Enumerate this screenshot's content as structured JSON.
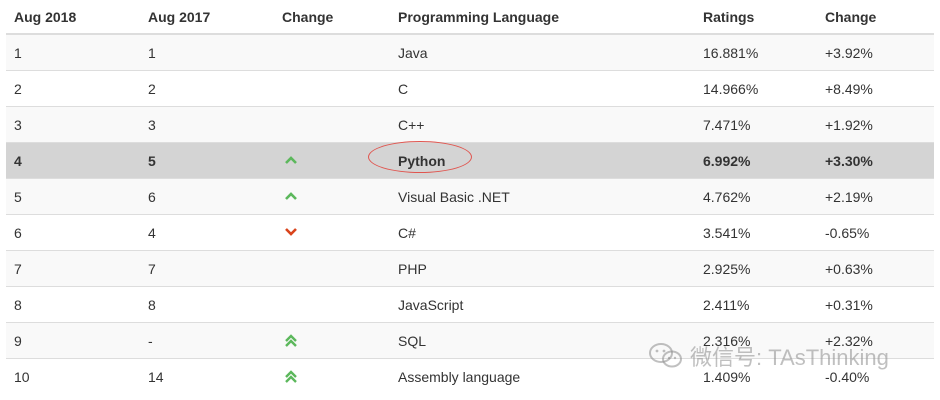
{
  "headers": [
    "Aug 2018",
    "Aug 2017",
    "Change",
    "Programming Language",
    "Ratings",
    "Change"
  ],
  "rows": [
    {
      "aug2018": "1",
      "aug2017": "1",
      "change_icon": "none",
      "language": "Java",
      "rating": "16.881%",
      "change": "+3.92%"
    },
    {
      "aug2018": "2",
      "aug2017": "2",
      "change_icon": "none",
      "language": "C",
      "rating": "14.966%",
      "change": "+8.49%"
    },
    {
      "aug2018": "3",
      "aug2017": "3",
      "change_icon": "none",
      "language": "C++",
      "rating": "7.471%",
      "change": "+1.92%"
    },
    {
      "aug2018": "4",
      "aug2017": "5",
      "change_icon": "up-icon",
      "language": "Python",
      "rating": "6.992%",
      "change": "+3.30%"
    },
    {
      "aug2018": "5",
      "aug2017": "6",
      "change_icon": "up-icon",
      "language": "Visual Basic .NET",
      "rating": "4.762%",
      "change": "+2.19%"
    },
    {
      "aug2018": "6",
      "aug2017": "4",
      "change_icon": "down-icon",
      "language": "C#",
      "rating": "3.541%",
      "change": "-0.65%"
    },
    {
      "aug2018": "7",
      "aug2017": "7",
      "change_icon": "none",
      "language": "PHP",
      "rating": "2.925%",
      "change": "+0.63%"
    },
    {
      "aug2018": "8",
      "aug2017": "8",
      "change_icon": "none",
      "language": "JavaScript",
      "rating": "2.411%",
      "change": "+0.31%"
    },
    {
      "aug2018": "9",
      "aug2017": "-",
      "change_icon": "double-up-icon",
      "language": "SQL",
      "rating": "2.316%",
      "change": "+2.32%"
    },
    {
      "aug2018": "10",
      "aug2017": "14",
      "change_icon": "double-up-icon",
      "language": "Assembly language",
      "rating": "1.409%",
      "change": "-0.40%"
    }
  ],
  "highlight_row": 3,
  "colors": {
    "up": "#5cb85c",
    "down": "#d9441c",
    "circle": "#e0554f",
    "highlight_bg": "#d4d4d4"
  },
  "watermark": {
    "icon": "wechat-icon",
    "text": "微信号: TAsThinking"
  }
}
